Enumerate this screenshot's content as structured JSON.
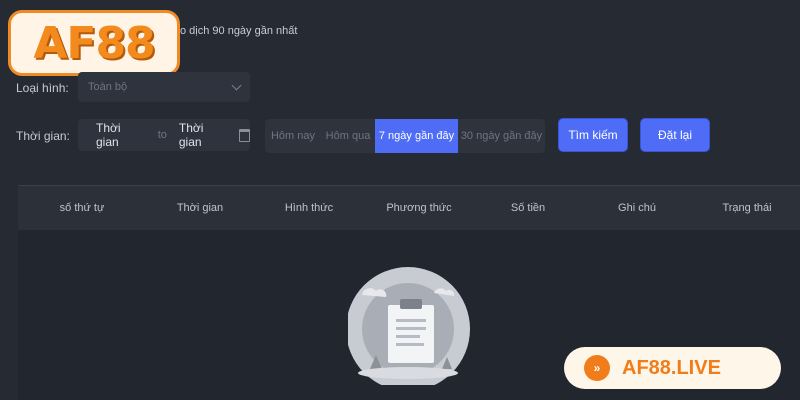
{
  "header": {
    "subtitle": "o dịch 90 ngày gần nhất",
    "logo_text": "AF88"
  },
  "filters": {
    "type_label": "Loại hình:",
    "type_value": "Toàn bộ",
    "time_label": "Thời gian:",
    "date_start": "Thời gian",
    "date_to": "to",
    "date_end": "Thời gian"
  },
  "quick_ranges": [
    {
      "label": "Hôm nay",
      "active": false
    },
    {
      "label": "Hôm qua",
      "active": false
    },
    {
      "label": "7 ngày gần đây",
      "active": true
    },
    {
      "label": "30 ngày gần đây",
      "active": false
    }
  ],
  "actions": {
    "search": "Tìm kiếm",
    "reset": "Đặt lại"
  },
  "table": {
    "columns": [
      "số thứ tự",
      "Thời gian",
      "Hình thức",
      "Phương thức",
      "Số tiền",
      "Ghi chú",
      "Trạng thái"
    ],
    "rows": []
  },
  "watermark": {
    "text": "AF88.LIVE"
  },
  "colors": {
    "background": "#262a33",
    "accent": "#4f6cf7",
    "brand_orange": "#f07c1a"
  }
}
